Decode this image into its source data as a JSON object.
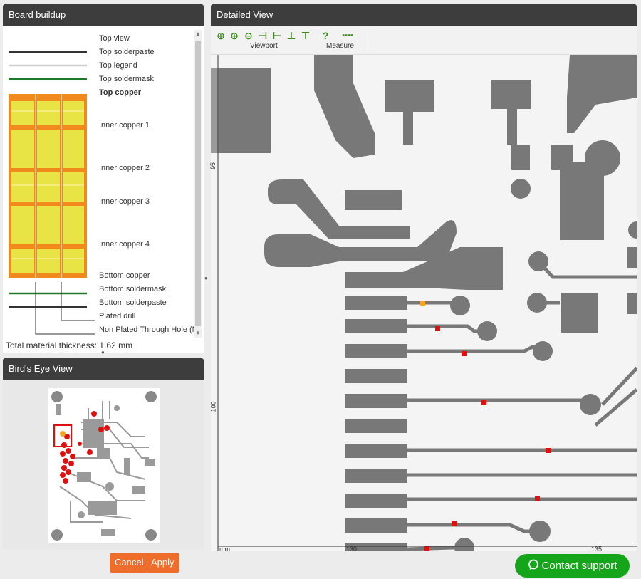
{
  "board_buildup": {
    "title": "Board buildup",
    "layers": [
      {
        "label": "Top view",
        "bold": false
      },
      {
        "label": "Top solderpaste",
        "bold": false
      },
      {
        "label": "Top legend",
        "bold": false
      },
      {
        "label": "Top soldermask",
        "bold": false
      },
      {
        "label": "Top copper",
        "bold": true
      },
      {
        "label": "Inner copper 1",
        "bold": false
      },
      {
        "label": "Inner copper 2",
        "bold": false
      },
      {
        "label": "Inner copper 3",
        "bold": false
      },
      {
        "label": "Inner copper 4",
        "bold": false
      },
      {
        "label": "Bottom copper",
        "bold": false
      },
      {
        "label": "Bottom soldermask",
        "bold": false
      },
      {
        "label": "Bottom solderpaste",
        "bold": false
      },
      {
        "label": "Plated drill",
        "bold": false
      },
      {
        "label": "Non Plated Through Hole (N"
      }
    ],
    "total_thickness": "Total material thickness: 1.62 mm"
  },
  "birds_eye": {
    "title": "Bird's Eye View"
  },
  "detailed_view": {
    "title": "Detailed View",
    "toolbar": {
      "viewport_label": "Viewport",
      "measure_label": "Measure",
      "icons": [
        "zoom-fit-icon",
        "zoom-in-icon",
        "zoom-out-icon",
        "pan-left-icon",
        "pan-right-icon",
        "pan-up-icon",
        "pan-down-icon",
        "help-icon",
        "measure-icon"
      ]
    },
    "ruler": {
      "y_ticks": [
        "95",
        "100"
      ],
      "x_ticks": [
        "130",
        "135"
      ],
      "unit": "mm"
    }
  },
  "actions": {
    "cancel": "Cancel",
    "apply": "Apply"
  },
  "support": {
    "label": "Contact support"
  },
  "colors": {
    "panel_header": "#3d3d3d",
    "copper": "#f08a1d",
    "prepreg": "#e8e446",
    "trace": "#787878",
    "marker_red": "#e01010",
    "marker_orange": "#f5a623",
    "button": "#ee6d2b",
    "support": "#14a51a"
  }
}
